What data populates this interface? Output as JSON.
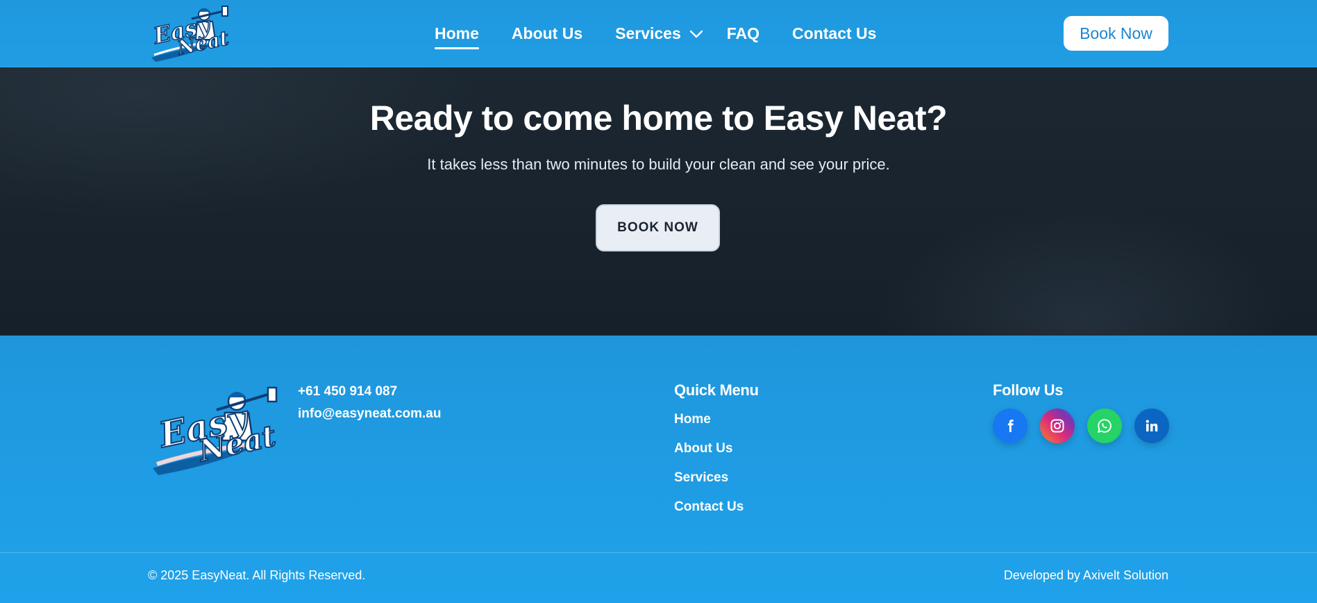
{
  "header": {
    "logo_alt": "Easy Neat",
    "nav": [
      {
        "label": "Home",
        "active": true
      },
      {
        "label": "About Us",
        "active": false
      },
      {
        "label": "Services",
        "active": false,
        "has_dropdown": true
      },
      {
        "label": "FAQ",
        "active": false
      },
      {
        "label": "Contact Us",
        "active": false
      }
    ],
    "book_button": "Book Now"
  },
  "hero": {
    "title": "Ready to come home to Easy Neat?",
    "subtitle": "It takes less than two minutes to build your clean and see your price.",
    "button": "BOOK NOW"
  },
  "footer": {
    "logo_alt": "Easy Neat",
    "phone": "+61 450 914 087",
    "email": "info@easyneat.com.au",
    "quick_menu_title": "Quick Menu",
    "quick_menu": [
      "Home",
      "About Us",
      "Services",
      "Contact Us"
    ],
    "follow_title": "Follow Us",
    "socials": [
      {
        "name": "facebook-icon"
      },
      {
        "name": "instagram-icon"
      },
      {
        "name": "whatsapp-icon"
      },
      {
        "name": "linkedin-icon"
      }
    ],
    "copyright": "© 2025 EasyNeat. All Rights Reserved.",
    "developed_by": "Developed by Axivelt Solution"
  },
  "colors": {
    "primary_blue": "#1f9de3",
    "hero_dark": "#1a242e",
    "button_text_blue": "#1c86cf"
  }
}
